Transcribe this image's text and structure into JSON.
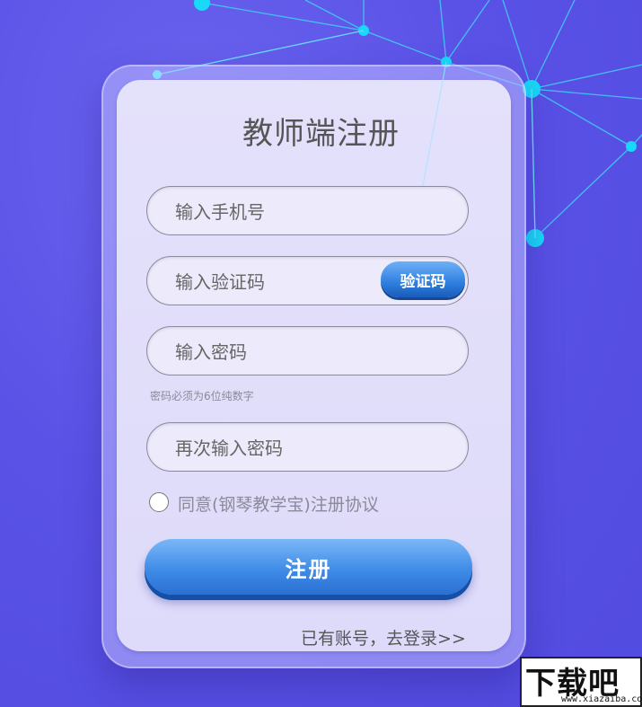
{
  "form": {
    "title": "教师端注册",
    "phone_placeholder": "输入手机号",
    "code_placeholder": "输入验证码",
    "code_button": "验证码",
    "password_placeholder": "输入密码",
    "password_hint": "密码必须为6位纯数字",
    "confirm_placeholder": "再次输入密码",
    "agreement_text": "同意(钢琴教学宝)注册协议",
    "agreement_checked": false,
    "submit_label": "注册",
    "login_link": "已有账号，去登录>>"
  },
  "watermark": {
    "main": "下载吧",
    "sub": "www.xiazaiba.com"
  },
  "colors": {
    "background": "#5a52e6",
    "network_line": "#3fd3f6",
    "button_blue": "#3f8ce8",
    "card": "#e2dffa"
  }
}
